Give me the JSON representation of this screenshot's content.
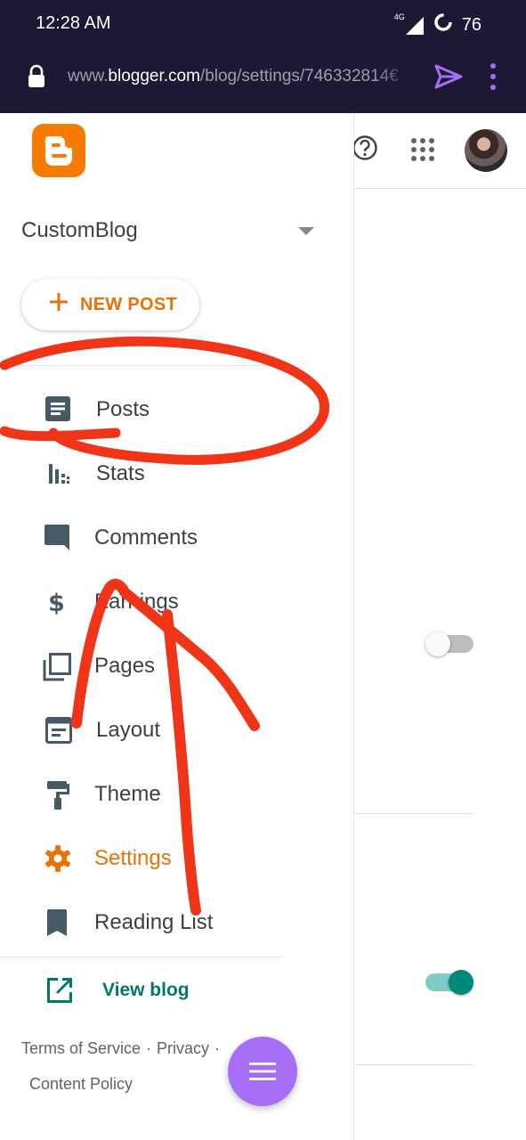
{
  "status_bar": {
    "time": "12:28 AM",
    "network": "4G",
    "battery": "76"
  },
  "browser": {
    "url_domain": "www.blogger.com",
    "url_path": "/blog/settings/746332814€",
    "url_prefix": "www."
  },
  "drawer": {
    "blog_name": "CustomBlog",
    "new_post_label": "NEW POST",
    "nav": [
      {
        "label": "Posts",
        "icon": "posts-icon"
      },
      {
        "label": "Stats",
        "icon": "stats-icon"
      },
      {
        "label": "Comments",
        "icon": "comment-icon"
      },
      {
        "label": "Earnings",
        "icon": "dollar-icon"
      },
      {
        "label": "Pages",
        "icon": "pages-icon"
      },
      {
        "label": "Layout",
        "icon": "layout-icon"
      },
      {
        "label": "Theme",
        "icon": "paint-roller-icon"
      },
      {
        "label": "Settings",
        "icon": "gear-icon",
        "active": true
      },
      {
        "label": "Reading List",
        "icon": "bookmark-icon"
      }
    ],
    "view_blog_label": "View blog",
    "footer": {
      "terms": "Terms of Service",
      "privacy": "Privacy",
      "content_policy": "Content Policy",
      "separator": "·"
    }
  },
  "colors": {
    "accent": "#e8710a",
    "teal": "#00796b",
    "fab": "#a66ef5",
    "annotation": "#f03418",
    "topbar": "#1c1935"
  },
  "settings_toggles": [
    {
      "on": false
    },
    {
      "on": true
    }
  ]
}
